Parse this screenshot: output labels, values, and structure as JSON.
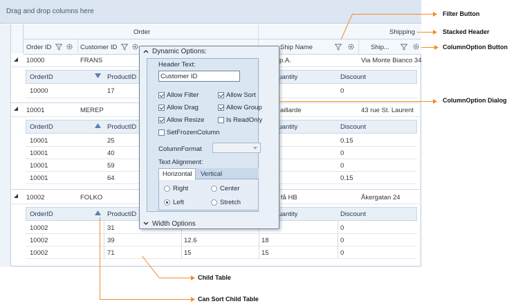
{
  "grid": {
    "group_drop_text": "Drag and drop columns here",
    "stacked_headers": {
      "order": "Order",
      "shipping": "Shipping"
    },
    "columns": [
      "Order ID",
      "Customer ID",
      "Ship Name",
      "Ship..."
    ],
    "rows": [
      {
        "order_id": "10000",
        "customer_id": "FRANS",
        "ship_name": "S.p.A.",
        "ship_addr": "Via Monte Bianco 34",
        "child": {
          "headers": [
            "OrderID",
            "ProductID",
            "Quantity",
            "Discount"
          ],
          "rows": [
            [
              "10000",
              "17",
              "",
              "0"
            ]
          ]
        }
      },
      {
        "order_id": "10001",
        "customer_id": "MEREP",
        "ship_name": "aillarde",
        "ship_addr": "43 rue St. Laurent",
        "child": {
          "headers": [
            "OrderID",
            "ProductID",
            "Quantity",
            "Discount"
          ],
          "rows": [
            [
              "10001",
              "25",
              "",
              "0.15"
            ],
            [
              "10001",
              "40",
              "",
              "0"
            ],
            [
              "10001",
              "59",
              "",
              "0"
            ],
            [
              "10001",
              "64",
              "",
              "0.15"
            ]
          ]
        }
      },
      {
        "order_id": "10002",
        "customer_id": "FOLKO",
        "ship_name": "h få HB",
        "ship_addr": "Åkergatan 24",
        "child": {
          "headers": [
            "OrderID",
            "ProductID",
            "Quantity",
            "Discount"
          ],
          "rows": [
            [
              "10002",
              "31",
              "",
              "0"
            ],
            [
              "10002",
              "39",
              "12.6",
              "18",
              "0"
            ],
            [
              "10002",
              "71",
              "15",
              "15",
              "0"
            ]
          ]
        }
      }
    ]
  },
  "dialog": {
    "title": "Dynamic Options:",
    "header_text_label": "Header Text:",
    "header_text_value": "Customer ID",
    "checks": [
      {
        "label": "Allow Filter",
        "checked": true
      },
      {
        "label": "Allow Sort",
        "checked": true
      },
      {
        "label": "Allow Drag",
        "checked": true
      },
      {
        "label": "Allow Group",
        "checked": true
      },
      {
        "label": "Allow Resize",
        "checked": true
      },
      {
        "label": "Is ReadOnly",
        "checked": false
      },
      {
        "label": "SetFrozenColumn",
        "checked": false
      }
    ],
    "column_format_label": "ColumnFormat",
    "text_alignment_label": "Text Alignment:",
    "tabs": [
      "Horizontal",
      "Vertical"
    ],
    "radios": [
      {
        "label": "Right",
        "checked": false
      },
      {
        "label": "Center",
        "checked": false
      },
      {
        "label": "Left",
        "checked": true
      },
      {
        "label": "Stretch",
        "checked": false
      }
    ],
    "width_options": "Width Options"
  },
  "annotations": {
    "filter_button": "Filter Button",
    "stacked_header": "Stacked Header",
    "column_option_button": "ColumnOption Button",
    "column_option_dialog": "ColumnOption Dialog",
    "child_table": "Child Table",
    "can_sort_child_table": "Can Sort Child Table"
  },
  "colors": {
    "accent": "#f28c28",
    "header_bg": "#dbe6f2",
    "border": "#b7c8db"
  },
  "icons": [
    "funnel-icon",
    "gear-icon",
    "expand-triangle-icon",
    "sort-ascending-icon",
    "sort-descending-icon",
    "chevron-up-icon",
    "chevron-down-icon",
    "dropdown-arrow-icon"
  ]
}
